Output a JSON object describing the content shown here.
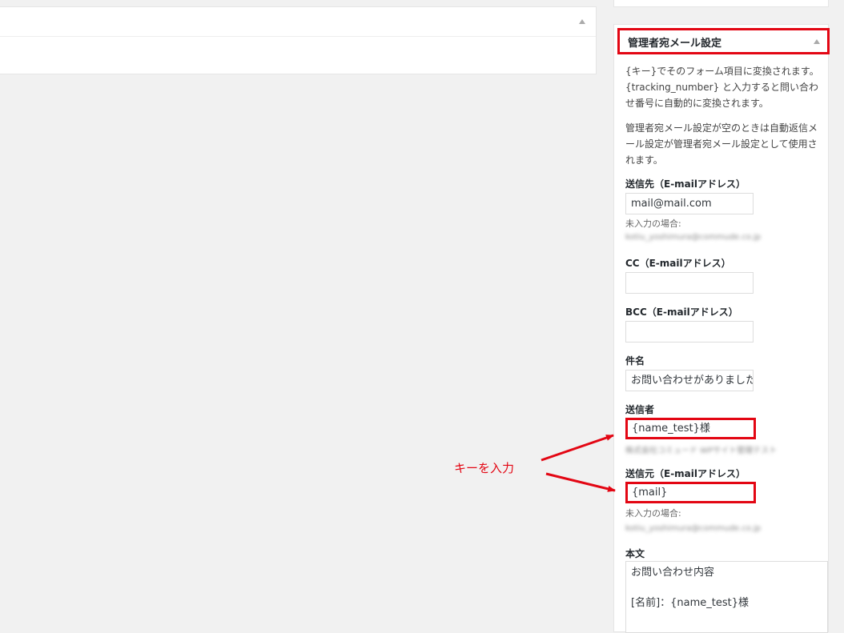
{
  "panel": {
    "title": "管理者宛メール設定",
    "desc1": "{キー}でそのフォーム項目に変換されます。 {tracking_number} と入力すると問い合わせ番号に自動的に変換されます。",
    "desc2": "管理者宛メール設定が空のときは自動返信メール設定が管理者宛メール設定として使用されます。"
  },
  "fields": {
    "to": {
      "label": "送信先（E-mailアドレス）",
      "value": "mail@mail.com",
      "hint": "未入力の場合:",
      "default_blurred": "kotiu_yoshimura@commude.co.jp"
    },
    "cc": {
      "label": "CC（E-mailアドレス）",
      "value": ""
    },
    "bcc": {
      "label": "BCC（E-mailアドレス）",
      "value": ""
    },
    "subject": {
      "label": "件名",
      "value": "お問い合わせがありました"
    },
    "sender": {
      "label": "送信者",
      "value": "{name_test}様",
      "default_blurred": "株式会社コミュード WPサイト管理テスト"
    },
    "from": {
      "label": "送信元（E-mailアドレス）",
      "value": "{mail}",
      "hint": "未入力の場合:",
      "default_blurred": "kotiu_yoshimura@commude.co.jp"
    },
    "body": {
      "label": "本文",
      "lines": [
        "お問い合わせ内容",
        "",
        "[名前]：{name_test}様"
      ]
    }
  },
  "annotation": {
    "text": "キーを入力",
    "color": "#e30613"
  },
  "colors": {
    "highlight": "#e30613",
    "background": "#f1f1f1"
  }
}
